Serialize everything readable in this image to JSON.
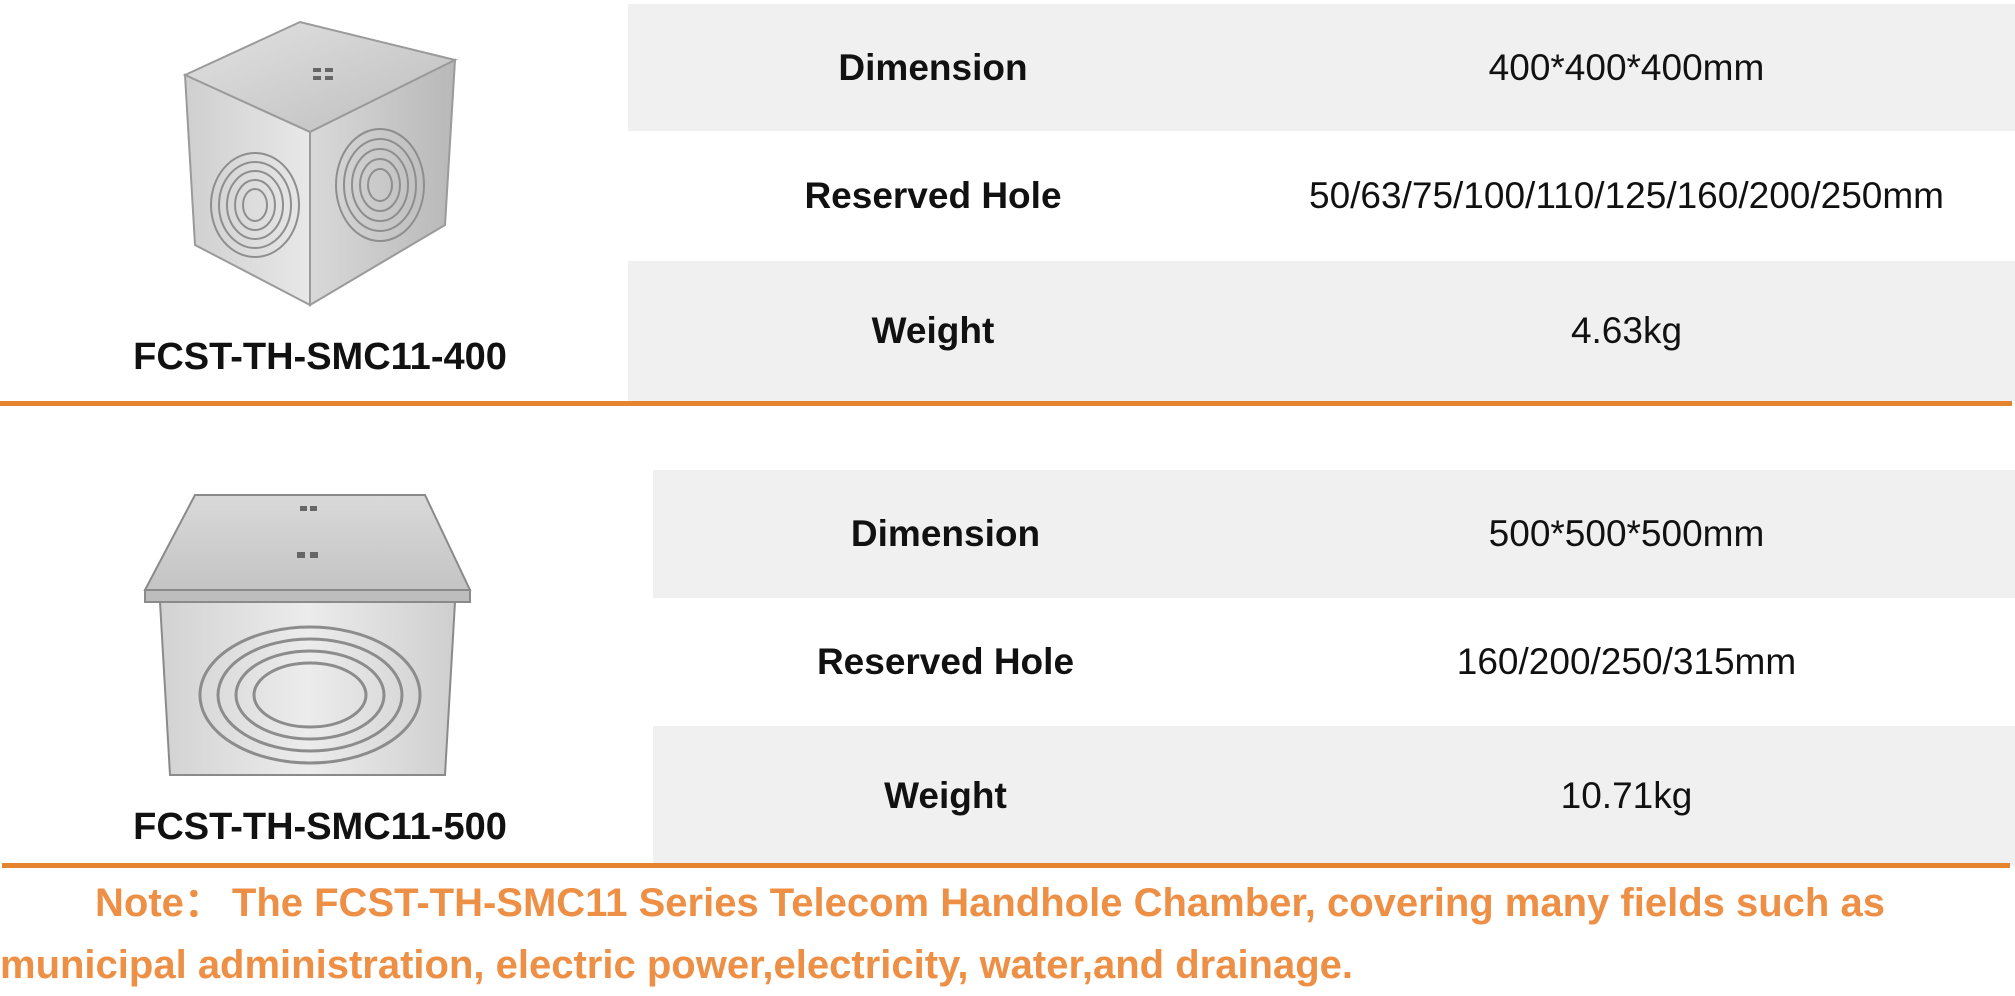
{
  "products": [
    {
      "name": "FCST-TH-SMC11-400",
      "image_icon": "handhole-chamber-400-icon",
      "specs": [
        {
          "label": "Dimension",
          "value": "400*400*400mm"
        },
        {
          "label": "Reserved Hole",
          "value": "50/63/75/100/110/125/160/200/250mm"
        },
        {
          "label": "Weight",
          "value": "4.63kg"
        }
      ]
    },
    {
      "name": "FCST-TH-SMC11-500",
      "image_icon": "handhole-chamber-500-icon",
      "specs": [
        {
          "label": "Dimension",
          "value": "500*500*500mm"
        },
        {
          "label": "Reserved Hole",
          "value": "160/200/250/315mm"
        },
        {
          "label": "Weight",
          "value": "10.71kg"
        }
      ]
    }
  ],
  "note": {
    "prefix": "Note：",
    "text": "The FCST-TH-SMC11 Series Telecom Handhole Chamber, covering many fields such as municipal administration, electric power,electricity, water,and drainage."
  },
  "colors": {
    "accent": "#e5832f",
    "note_text": "#ee8f46",
    "row_shade": "#f0f0f0",
    "text": "#111111"
  }
}
